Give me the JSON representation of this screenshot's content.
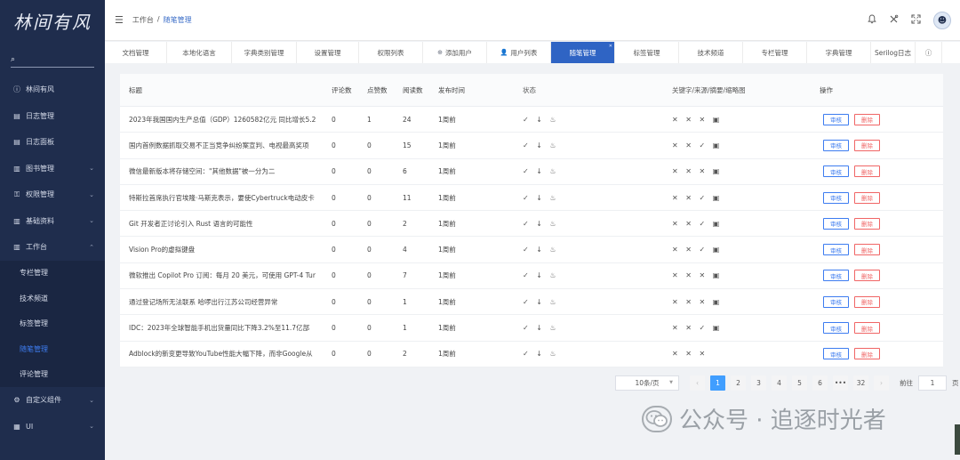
{
  "sidebar": {
    "logo": "林间有风",
    "items": [
      {
        "label": "林间有风",
        "icon": "ⓘ",
        "chev": ""
      },
      {
        "label": "日志管理",
        "icon": "▤",
        "chev": ""
      },
      {
        "label": "日志面板",
        "icon": "▤",
        "chev": ""
      },
      {
        "label": "图书管理",
        "icon": "▥",
        "chev": "⌄"
      },
      {
        "label": "权限管理",
        "icon": "⚿",
        "chev": "⌄"
      },
      {
        "label": "基础资料",
        "icon": "▥",
        "chev": "⌄"
      },
      {
        "label": "工作台",
        "icon": "▥",
        "chev": "⌃"
      }
    ],
    "subitems": [
      "专栏管理",
      "技术频道",
      "标签管理",
      "随笔管理",
      "评论管理"
    ],
    "items_bottom": [
      {
        "label": "自定义组件",
        "icon": "⚙",
        "chev": "⌄"
      },
      {
        "label": "UI",
        "icon": "▦",
        "chev": "⌄"
      }
    ]
  },
  "header": {
    "menu_icon": "☰",
    "breadcrumb_root": "工作台",
    "breadcrumb_sep": "/",
    "breadcrumb_current": "随笔管理",
    "icons": [
      "bell-icon",
      "tools-icon",
      "fullscreen-icon"
    ]
  },
  "tabs": [
    {
      "label": "文档管理",
      "w": 70,
      "icon": ""
    },
    {
      "label": "本地化语言",
      "w": 73,
      "icon": ""
    },
    {
      "label": "字典类别管理",
      "w": 73,
      "icon": ""
    },
    {
      "label": "设置管理",
      "w": 70,
      "icon": ""
    },
    {
      "label": "权限列表",
      "w": 72,
      "icon": ""
    },
    {
      "label": "添加用户",
      "w": 72,
      "icon": "⊕"
    },
    {
      "label": "用户列表",
      "w": 72,
      "icon": "👤"
    },
    {
      "label": "随笔管理",
      "w": 72,
      "icon": "",
      "active": true
    },
    {
      "label": "标签管理",
      "w": 72,
      "icon": ""
    },
    {
      "label": "技术频道",
      "w": 72,
      "icon": ""
    },
    {
      "label": "专栏管理",
      "w": 72,
      "icon": ""
    },
    {
      "label": "字典管理",
      "w": 72,
      "icon": ""
    },
    {
      "label": "Serilog日志",
      "w": 50,
      "icon": ""
    },
    {
      "label": "ⓘ",
      "w": 30,
      "icon": ""
    }
  ],
  "table": {
    "headers": {
      "title": "标题",
      "comments": "评论数",
      "likes": "点赞数",
      "reads": "阅读数",
      "time": "发布时间",
      "status": "状态",
      "keywords": "关键字/来源/摘要/缩略图",
      "ops": "操作"
    },
    "review_label": "审核",
    "delete_label": "删除",
    "rows": [
      {
        "title": "2023年我国国内生产总值（GDP）1260582亿元 同比增长5.2",
        "comments": "0",
        "likes": "1",
        "reads": "24",
        "time": "1周前",
        "status": "✓ ↓ ♨",
        "keywords": "✕ ✕ ✕ ▣"
      },
      {
        "title": "国内首例数据抓取交易不正当竞争纠纷案宣判、电视最高奖项",
        "comments": "0",
        "likes": "0",
        "reads": "15",
        "time": "1周前",
        "status": "✓ ↓ ♨",
        "keywords": "✕ ✕ ✓ ▣"
      },
      {
        "title": "微信最新版本将存储空间：\"其他数据\"被一分为二",
        "comments": "0",
        "likes": "0",
        "reads": "6",
        "time": "1周前",
        "status": "✓ ↓ ♨",
        "keywords": "✕ ✕ ✕ ▣"
      },
      {
        "title": "特斯拉首席执行官埃隆·马斯克表示，要使Cybertruck电动皮卡",
        "comments": "0",
        "likes": "0",
        "reads": "11",
        "time": "1周前",
        "status": "✓ ↓ ♨",
        "keywords": "✕ ✕ ✓ ▣"
      },
      {
        "title": "Git 开发者正讨论引入 Rust 语言的可能性",
        "comments": "0",
        "likes": "0",
        "reads": "2",
        "time": "1周前",
        "status": "✓ ↓ ♨",
        "keywords": "✕ ✕ ✓ ▣"
      },
      {
        "title": "Vision Pro的虚拟键盘",
        "comments": "0",
        "likes": "0",
        "reads": "4",
        "time": "1周前",
        "status": "✓ ↓ ♨",
        "keywords": "✕ ✕ ✓ ▣"
      },
      {
        "title": "微软推出 Copilot Pro 订阅：每月 20 美元，可使用 GPT-4 Tur",
        "comments": "0",
        "likes": "0",
        "reads": "7",
        "time": "1周前",
        "status": "✓ ↓ ♨",
        "keywords": "✕ ✕ ✕ ▣"
      },
      {
        "title": "通过登记场所无法联系 哈啰出行江苏公司经营异常",
        "comments": "0",
        "likes": "0",
        "reads": "1",
        "time": "1周前",
        "status": "✓ ↓ ♨",
        "keywords": "✕ ✕ ✕ ▣"
      },
      {
        "title": "IDC：2023年全球智能手机出货量同比下降3.2%至11.7亿部",
        "comments": "0",
        "likes": "0",
        "reads": "1",
        "time": "1周前",
        "status": "✓ ↓ ♨",
        "keywords": "✕ ✕ ✓ ▣"
      },
      {
        "title": "Adblock的新变更导致YouTube性能大幅下降，而非Google从",
        "comments": "0",
        "likes": "0",
        "reads": "2",
        "time": "1周前",
        "status": "✓ ↓ ♨",
        "keywords": "✕ ✕ ✕"
      }
    ]
  },
  "pagination": {
    "page_size": "10条/页",
    "prev": "‹",
    "next": "›",
    "pages": [
      "1",
      "2",
      "3",
      "4",
      "5",
      "6",
      "•••",
      "32"
    ],
    "current": "1",
    "goto_label": "前往",
    "goto_value": "1",
    "page_unit": "页"
  },
  "watermark": {
    "text": "公众号 · 追逐时光者"
  }
}
